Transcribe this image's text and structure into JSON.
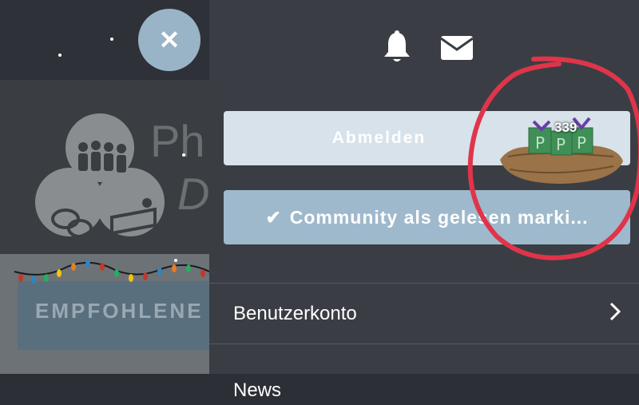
{
  "background": {
    "logo_text_top": "Ph",
    "logo_text_bottom": "D",
    "card_title": "EMPFOHLENE I"
  },
  "header": {
    "close_icon": "close-icon",
    "bell_icon": "bell-icon",
    "mail_icon": "mail-icon"
  },
  "drawer": {
    "logout_label": "Abmelden",
    "community_label": "Community als gelesen marki...",
    "community_icon": "check-icon",
    "badge_count": "339",
    "menu": [
      {
        "label": "Benutzerkonto",
        "icon": "chevron-right-icon"
      },
      {
        "label": "News"
      }
    ]
  },
  "colors": {
    "drawer_bg": "#3a3e44",
    "logout_bg": "#d7e2ea",
    "community_bg": "#9fb9cc",
    "close_bg": "#9ab4c7",
    "annotation_red": "#e0344a"
  }
}
